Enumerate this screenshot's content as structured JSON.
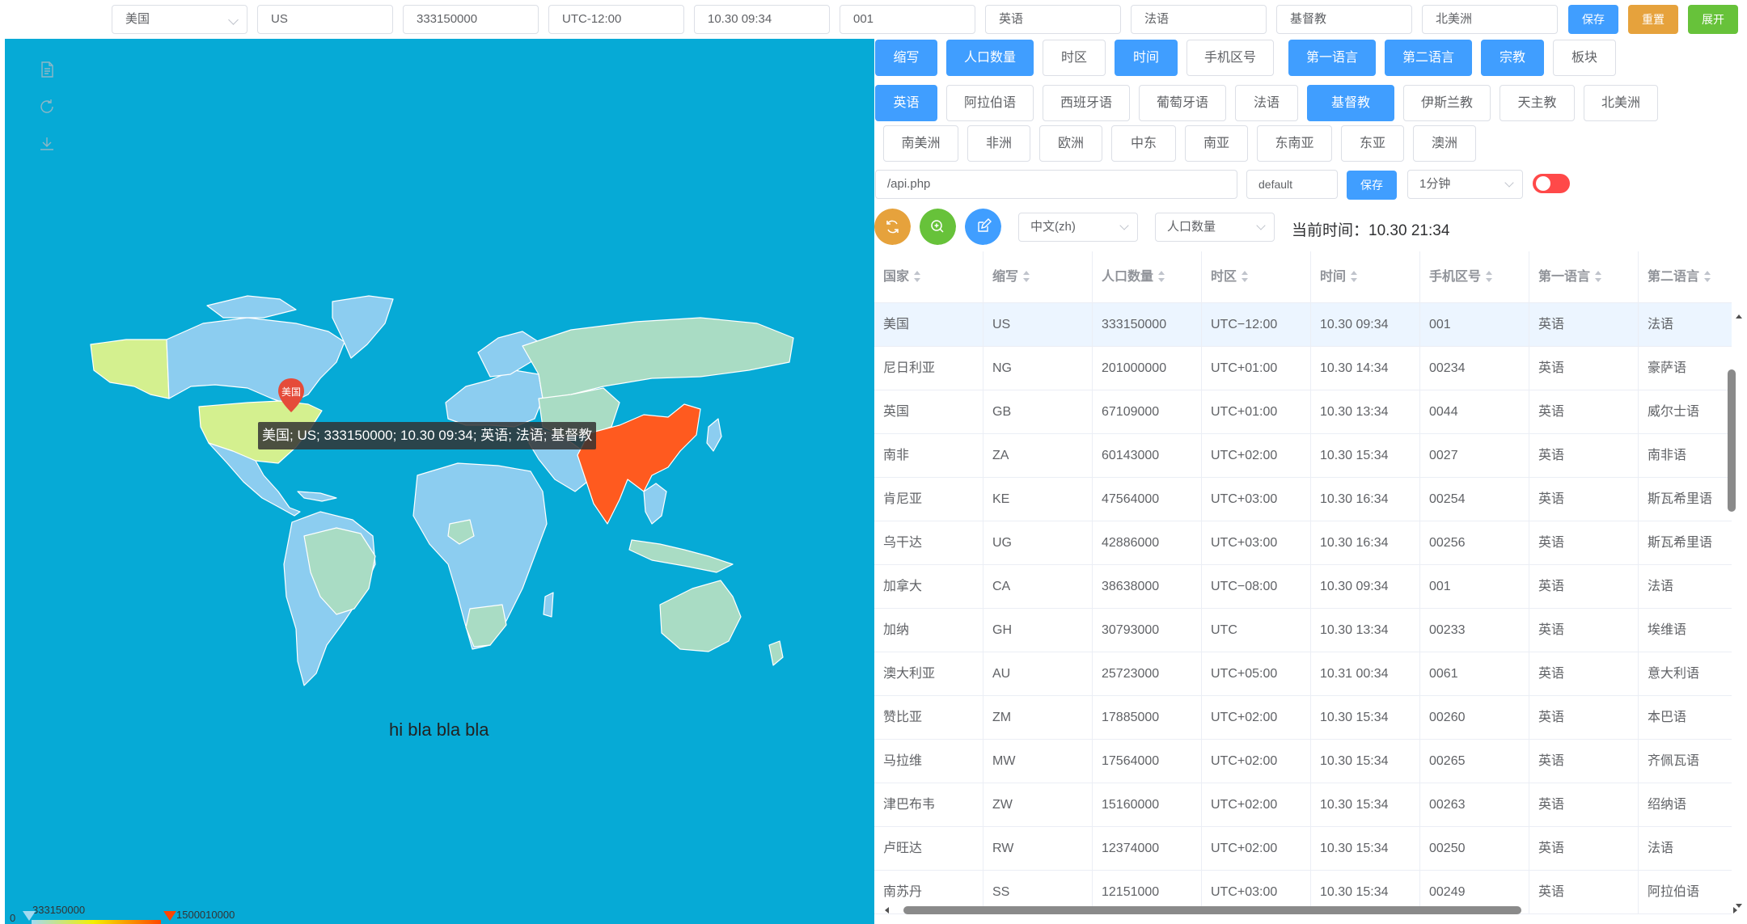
{
  "topbar": {
    "country": "美国",
    "code": "US",
    "population": "333150000",
    "timezone": "UTC-12:00",
    "time": "10.30 09:34",
    "phone_code": "001",
    "first_lang": "英语",
    "second_lang": "法语",
    "religion": "基督教",
    "region": "北美洲",
    "save": "保存",
    "reset": "重置",
    "expand": "展开"
  },
  "colors": {
    "primary": "#409eff",
    "warning": "#e6a23c",
    "success": "#67c23a",
    "danger": "#ff4949",
    "map_bg": "#06aad6",
    "china": "#ff5a1f"
  },
  "map": {
    "marker_label": "美国",
    "tooltip": "美国; US; 333150000; 10.30 09:34; 英语; 法语; 基督教",
    "caption": "hi bla bla bla",
    "visualmap": {
      "min": "0",
      "low": "333150000",
      "high": "1500010000",
      "min_value": 0,
      "max_value": 1500010000
    },
    "toolbox": [
      "data-view-icon",
      "restore-icon",
      "save-image-icon"
    ]
  },
  "columns_row": [
    "缩写",
    "人口数量",
    "时区",
    "时间",
    "手机区号",
    "第一语言",
    "第二语言",
    "宗教",
    "板块"
  ],
  "filters_row1": [
    "英语",
    "阿拉伯语",
    "西班牙语",
    "葡萄牙语",
    "法语",
    "基督教",
    "伊斯兰教",
    "天主教",
    "北美洲"
  ],
  "filters_row2": [
    "南美洲",
    "非洲",
    "欧洲",
    "中东",
    "南亚",
    "东南亚",
    "东亚",
    "澳洲"
  ],
  "api": {
    "url": "/api.php",
    "config": "default",
    "save": "保存",
    "interval": "1分钟"
  },
  "controls": {
    "lang": "中文(zh)",
    "sort_by": "人口数量",
    "now_label": "当前时间：",
    "now_value": "10.30 21:34"
  },
  "table": {
    "headers": [
      "国家",
      "缩写",
      "人口数量",
      "时区",
      "时间",
      "手机区号",
      "第一语言",
      "第二语言"
    ],
    "rows": [
      [
        "美国",
        "US",
        "333150000",
        "UTC−12:00",
        "10.30 09:34",
        "001",
        "英语",
        "法语"
      ],
      [
        "尼日利亚",
        "NG",
        "201000000",
        "UTC+01:00",
        "10.30 14:34",
        "00234",
        "英语",
        "豪萨语"
      ],
      [
        "英国",
        "GB",
        "67109000",
        "UTC+01:00",
        "10.30 13:34",
        "0044",
        "英语",
        "威尔士语"
      ],
      [
        "南非",
        "ZA",
        "60143000",
        "UTC+02:00",
        "10.30 15:34",
        "0027",
        "英语",
        "南非语"
      ],
      [
        "肯尼亚",
        "KE",
        "47564000",
        "UTC+03:00",
        "10.30 16:34",
        "00254",
        "英语",
        "斯瓦希里语"
      ],
      [
        "乌干达",
        "UG",
        "42886000",
        "UTC+03:00",
        "10.30 16:34",
        "00256",
        "英语",
        "斯瓦希里语"
      ],
      [
        "加拿大",
        "CA",
        "38638000",
        "UTC−08:00",
        "10.30 09:34",
        "001",
        "英语",
        "法语"
      ],
      [
        "加纳",
        "GH",
        "30793000",
        "UTC",
        "10.30 13:34",
        "00233",
        "英语",
        "埃维语"
      ],
      [
        "澳大利亚",
        "AU",
        "25723000",
        "UTC+05:00",
        "10.31 00:34",
        "0061",
        "英语",
        "意大利语"
      ],
      [
        "赞比亚",
        "ZM",
        "17885000",
        "UTC+02:00",
        "10.30 15:34",
        "00260",
        "英语",
        "本巴语"
      ],
      [
        "马拉维",
        "MW",
        "17564000",
        "UTC+02:00",
        "10.30 15:34",
        "00265",
        "英语",
        "齐佩瓦语"
      ],
      [
        "津巴布韦",
        "ZW",
        "15160000",
        "UTC+02:00",
        "10.30 15:34",
        "00263",
        "英语",
        "绍纳语"
      ],
      [
        "卢旺达",
        "RW",
        "12374000",
        "UTC+02:00",
        "10.30 15:34",
        "00250",
        "英语",
        "法语"
      ],
      [
        "南苏丹",
        "SS",
        "12151000",
        "UTC+03:00",
        "10.30 15:34",
        "00249",
        "英语",
        "阿拉伯语"
      ]
    ]
  }
}
